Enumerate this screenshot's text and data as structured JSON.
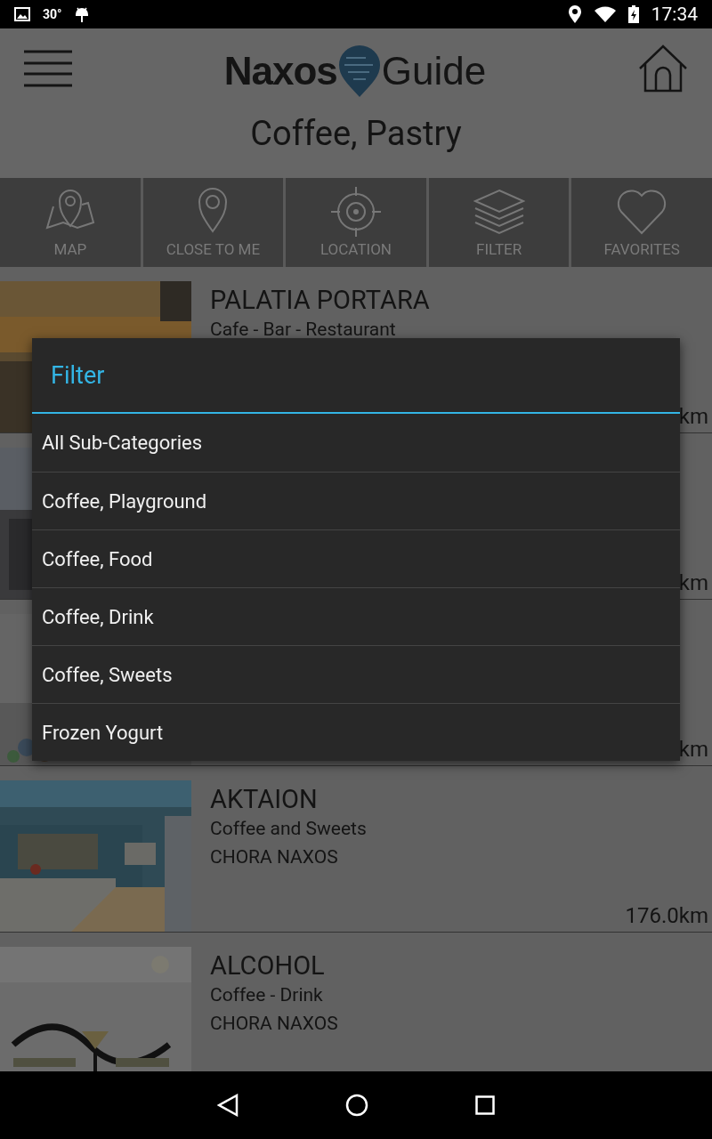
{
  "status_bar": {
    "temperature": "30°",
    "time": "17:34"
  },
  "header": {
    "logo": {
      "bold_text": "Naxos",
      "light_text": "Guide"
    },
    "category": "Coffee, Pastry"
  },
  "toolbar": [
    {
      "label": "MAP"
    },
    {
      "label": "CLOSE TO ME"
    },
    {
      "label": "LOCATION"
    },
    {
      "label": "FILTER"
    },
    {
      "label": "FAVORITES"
    }
  ],
  "listings": [
    {
      "title": "PALATIA PORTARA",
      "subtitle": "Cafe - Bar - Restaurant",
      "distance": "km"
    },
    {
      "distance": "km"
    },
    {
      "distance": "km"
    },
    {
      "title": "AKTAION",
      "subtitle": "Coffee and Sweets",
      "location": "CHORA NAXOS",
      "distance": "176.0km"
    },
    {
      "title": "ALCOHOL",
      "subtitle": "Coffee - Drink",
      "location": "CHORA NAXOS"
    }
  ],
  "dialog": {
    "title": "Filter",
    "options": [
      {
        "label": "All Sub-Categories"
      },
      {
        "label": "Coffee, Playground"
      },
      {
        "label": "Coffee, Food"
      },
      {
        "label": "Coffee, Drink"
      },
      {
        "label": "Coffee, Sweets"
      },
      {
        "label": "Frozen Yogurt"
      }
    ]
  }
}
